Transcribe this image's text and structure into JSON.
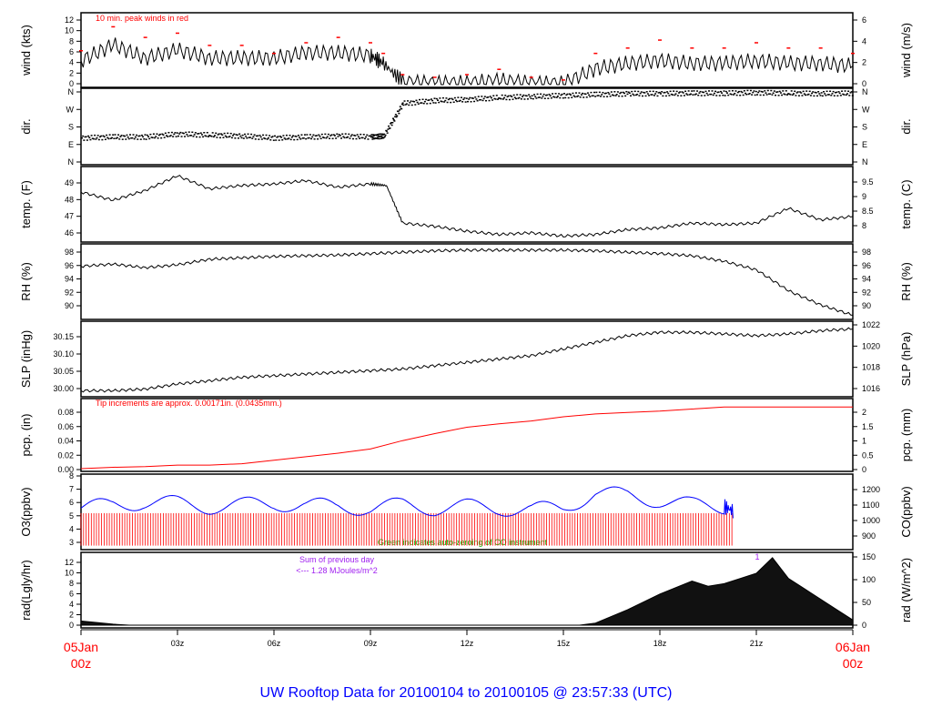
{
  "title": "UW Rooftop Data for 20100104  to  20100105 @ 23:57:33  (UTC)",
  "x_axis": {
    "start_date": "05Jan",
    "start_hour": "00z",
    "end_date": "06Jan",
    "end_hour": "00z",
    "hour_ticks": [
      "03z",
      "06z",
      "09z",
      "12z",
      "15z",
      "18z",
      "21z"
    ],
    "range_hours": [
      0,
      24
    ]
  },
  "annotations": {
    "peak_winds": "10 min. peak winds in red",
    "tip_increments": "Tip increments are approx. 0.00171in. (0.0435mm.)",
    "green_note": "Green indicates auto-zeroing of CO instrument",
    "sum_prev_day": "Sum of previous day",
    "sum_value": "<--- 1.28 MJoules/m^2",
    "marker": "1"
  },
  "colors": {
    "peak": "#ff0000",
    "o3": "#ff0000",
    "co": "#0000ff",
    "zeroing": "#00c000",
    "pcp": "#ff0000",
    "rad": "#111111",
    "annotation": "#a020f0",
    "title": "#0000ff"
  },
  "chart_data": [
    {
      "type": "line",
      "id": "wind",
      "ylabel": "wind (kts)",
      "ylabel_right": "wind (m/s)",
      "ylim": [
        0,
        13
      ],
      "yticks": [
        "0",
        "2",
        "4",
        "6",
        "8",
        "10",
        "12"
      ],
      "yticks_right": [
        "0",
        "2",
        "4",
        "6"
      ],
      "x": [
        0,
        1,
        2,
        3,
        4,
        5,
        6,
        7,
        8,
        9,
        9.4,
        10,
        11,
        12,
        13,
        14,
        15,
        16,
        17,
        18,
        19,
        20,
        21,
        22,
        23,
        24
      ],
      "values": [
        4.5,
        7.5,
        5,
        6.5,
        5,
        5,
        5,
        6,
        6,
        5.5,
        4,
        0.5,
        0.3,
        0.3,
        0.8,
        0.3,
        0.2,
        3,
        4,
        4.5,
        4,
        4,
        4.5,
        4,
        4,
        3.5
      ],
      "peak": [
        6.5,
        11,
        9,
        9.8,
        7.5,
        7.5,
        6,
        8,
        9,
        8,
        6,
        2,
        1.5,
        2,
        3,
        1.5,
        1,
        6,
        7,
        8.5,
        7,
        7,
        8,
        7,
        7,
        6
      ]
    },
    {
      "type": "scatter",
      "id": "dir",
      "ylabel": "dir.",
      "ylabel_right": "dir.",
      "ylim": [
        0,
        360
      ],
      "yticks": [
        "N",
        "E",
        "S",
        "W",
        "N"
      ],
      "x": [
        0,
        1,
        2,
        3,
        4,
        5,
        6,
        7,
        8,
        9,
        9.4,
        10,
        11,
        12,
        13,
        14,
        15,
        16,
        17,
        18,
        19,
        20,
        21,
        22,
        23,
        24
      ],
      "values": [
        125,
        130,
        130,
        145,
        140,
        135,
        125,
        130,
        135,
        130,
        135,
        300,
        315,
        320,
        330,
        335,
        340,
        345,
        350,
        350,
        352,
        352,
        355,
        352,
        350,
        352
      ]
    },
    {
      "type": "line",
      "id": "temp",
      "ylabel": "temp. (F)",
      "ylabel_right": "temp. (C)",
      "ylim": [
        45.6,
        49.9
      ],
      "yticks": [
        "46",
        "47",
        "48",
        "49"
      ],
      "yticks_right": [
        "8",
        "8.5",
        "9",
        "9.5"
      ],
      "x": [
        0,
        1,
        2,
        3,
        4,
        5,
        6,
        7,
        8,
        9,
        9.5,
        10,
        11,
        12,
        13,
        14,
        15,
        16,
        17,
        18,
        19,
        20,
        21,
        22,
        23,
        24
      ],
      "values": [
        48.5,
        48,
        48.6,
        49.5,
        48.7,
        48.9,
        49,
        49.2,
        48.8,
        49,
        48.9,
        46.6,
        46.4,
        46.1,
        45.9,
        46,
        45.8,
        45.9,
        46.2,
        46.3,
        46.6,
        46.5,
        46.6,
        47.5,
        46.8,
        47
      ]
    },
    {
      "type": "line",
      "id": "rh",
      "ylabel": "RH (%)",
      "ylabel_right": "RH (%)",
      "ylim": [
        88.8,
        98.8
      ],
      "yticks": [
        "90",
        "92",
        "94",
        "96",
        "98"
      ],
      "yticks_right": [
        "90",
        "92",
        "94",
        "96",
        "98"
      ],
      "x": [
        0,
        1,
        2,
        3,
        4,
        5,
        6,
        7,
        8,
        9,
        10,
        11,
        12,
        13,
        14,
        15,
        16,
        17,
        18,
        19,
        20,
        21,
        22,
        23,
        24
      ],
      "values": [
        96,
        96.3,
        95.8,
        96.2,
        97,
        97.2,
        97.4,
        97.5,
        97.6,
        97.8,
        98,
        98.2,
        98.3,
        98.3,
        98.3,
        98.3,
        98.2,
        98,
        97.8,
        97.5,
        96.7,
        95.5,
        92.5,
        90.5,
        89
      ]
    },
    {
      "type": "line",
      "id": "slp",
      "ylabel": "SLP (inHg)",
      "ylabel_right": "SLP (hPa)",
      "ylim": [
        29.985,
        30.195
      ],
      "yticks": [
        "30.00",
        "30.05",
        "30.10",
        "30.15"
      ],
      "yticks_right": [
        "1016",
        "1018",
        "1020",
        "1022"
      ],
      "x": [
        0,
        1,
        2,
        3,
        4,
        5,
        6,
        7,
        8,
        9,
        10,
        11,
        12,
        13,
        14,
        15,
        16,
        17,
        18,
        19,
        20,
        21,
        22,
        23,
        24
      ],
      "values": [
        29.995,
        29.995,
        30.0,
        30.015,
        30.025,
        30.035,
        30.04,
        30.045,
        30.05,
        30.055,
        30.06,
        30.07,
        30.08,
        30.09,
        30.1,
        30.12,
        30.14,
        30.16,
        30.17,
        30.17,
        30.165,
        30.16,
        30.165,
        30.175,
        30.18
      ]
    },
    {
      "type": "line",
      "id": "pcp",
      "ylabel": "pcp. (in)",
      "ylabel_right": "pcp. (mm)",
      "ylim": [
        0,
        0.096
      ],
      "yticks": [
        "0.00",
        "0.02",
        "0.04",
        "0.06",
        "0.08"
      ],
      "yticks_right": [
        "0",
        "0.5",
        "1",
        "1.5",
        "2"
      ],
      "x": [
        0,
        1,
        2,
        3,
        4,
        5,
        6,
        7,
        8,
        9,
        10,
        11,
        12,
        13,
        14,
        15,
        16,
        17,
        18,
        19,
        20,
        21,
        22,
        23,
        24
      ],
      "values": [
        0,
        0.002,
        0.003,
        0.005,
        0.005,
        0.007,
        0.012,
        0.017,
        0.022,
        0.028,
        0.04,
        0.05,
        0.059,
        0.064,
        0.068,
        0.074,
        0.078,
        0.08,
        0.082,
        0.085,
        0.088,
        0.088,
        0.088,
        0.088,
        0.088
      ]
    },
    {
      "type": "line",
      "id": "o3co",
      "ylabel": "O3(ppbv)",
      "ylabel_right": "CO(ppbv)",
      "ylim": [
        2.6,
        8
      ],
      "yticks": [
        "3",
        "4",
        "5",
        "6",
        "7",
        "8"
      ],
      "yticks_right": [
        "900",
        "1000",
        "1100",
        "1200"
      ],
      "o3_range": [
        2.7,
        5.2
      ],
      "co_x": [
        0,
        1,
        2,
        3,
        4,
        5,
        6,
        7,
        8,
        9,
        10,
        11,
        12,
        13,
        14,
        15,
        16,
        17,
        18,
        19,
        20,
        20.3
      ],
      "co_values": [
        1080,
        1100,
        1120,
        1110,
        1090,
        1100,
        1110,
        1100,
        1090,
        1080,
        1100,
        1080,
        1090,
        1080,
        1070,
        1080,
        1180,
        1160,
        1130,
        1100,
        1090,
        1060
      ]
    },
    {
      "type": "area",
      "id": "rad",
      "ylabel": "rad(Lgly/hr)",
      "ylabel_right": "rad (W/m^2)",
      "ylim": [
        0,
        13.5
      ],
      "yticks": [
        "0",
        "2",
        "4",
        "6",
        "8",
        "10",
        "12"
      ],
      "yticks_right": [
        "0",
        "50",
        "100",
        "150"
      ],
      "x": [
        0,
        0.5,
        1,
        1.5,
        15.5,
        16,
        17,
        18,
        19,
        19.5,
        20,
        20.5,
        21,
        21.5,
        22,
        22.5,
        23,
        23.5,
        24
      ],
      "values": [
        0.8,
        0.5,
        0.2,
        0,
        0,
        0.4,
        3,
        6,
        8.5,
        7.5,
        8,
        9,
        10,
        13,
        9,
        7,
        5,
        3,
        1
      ]
    }
  ]
}
